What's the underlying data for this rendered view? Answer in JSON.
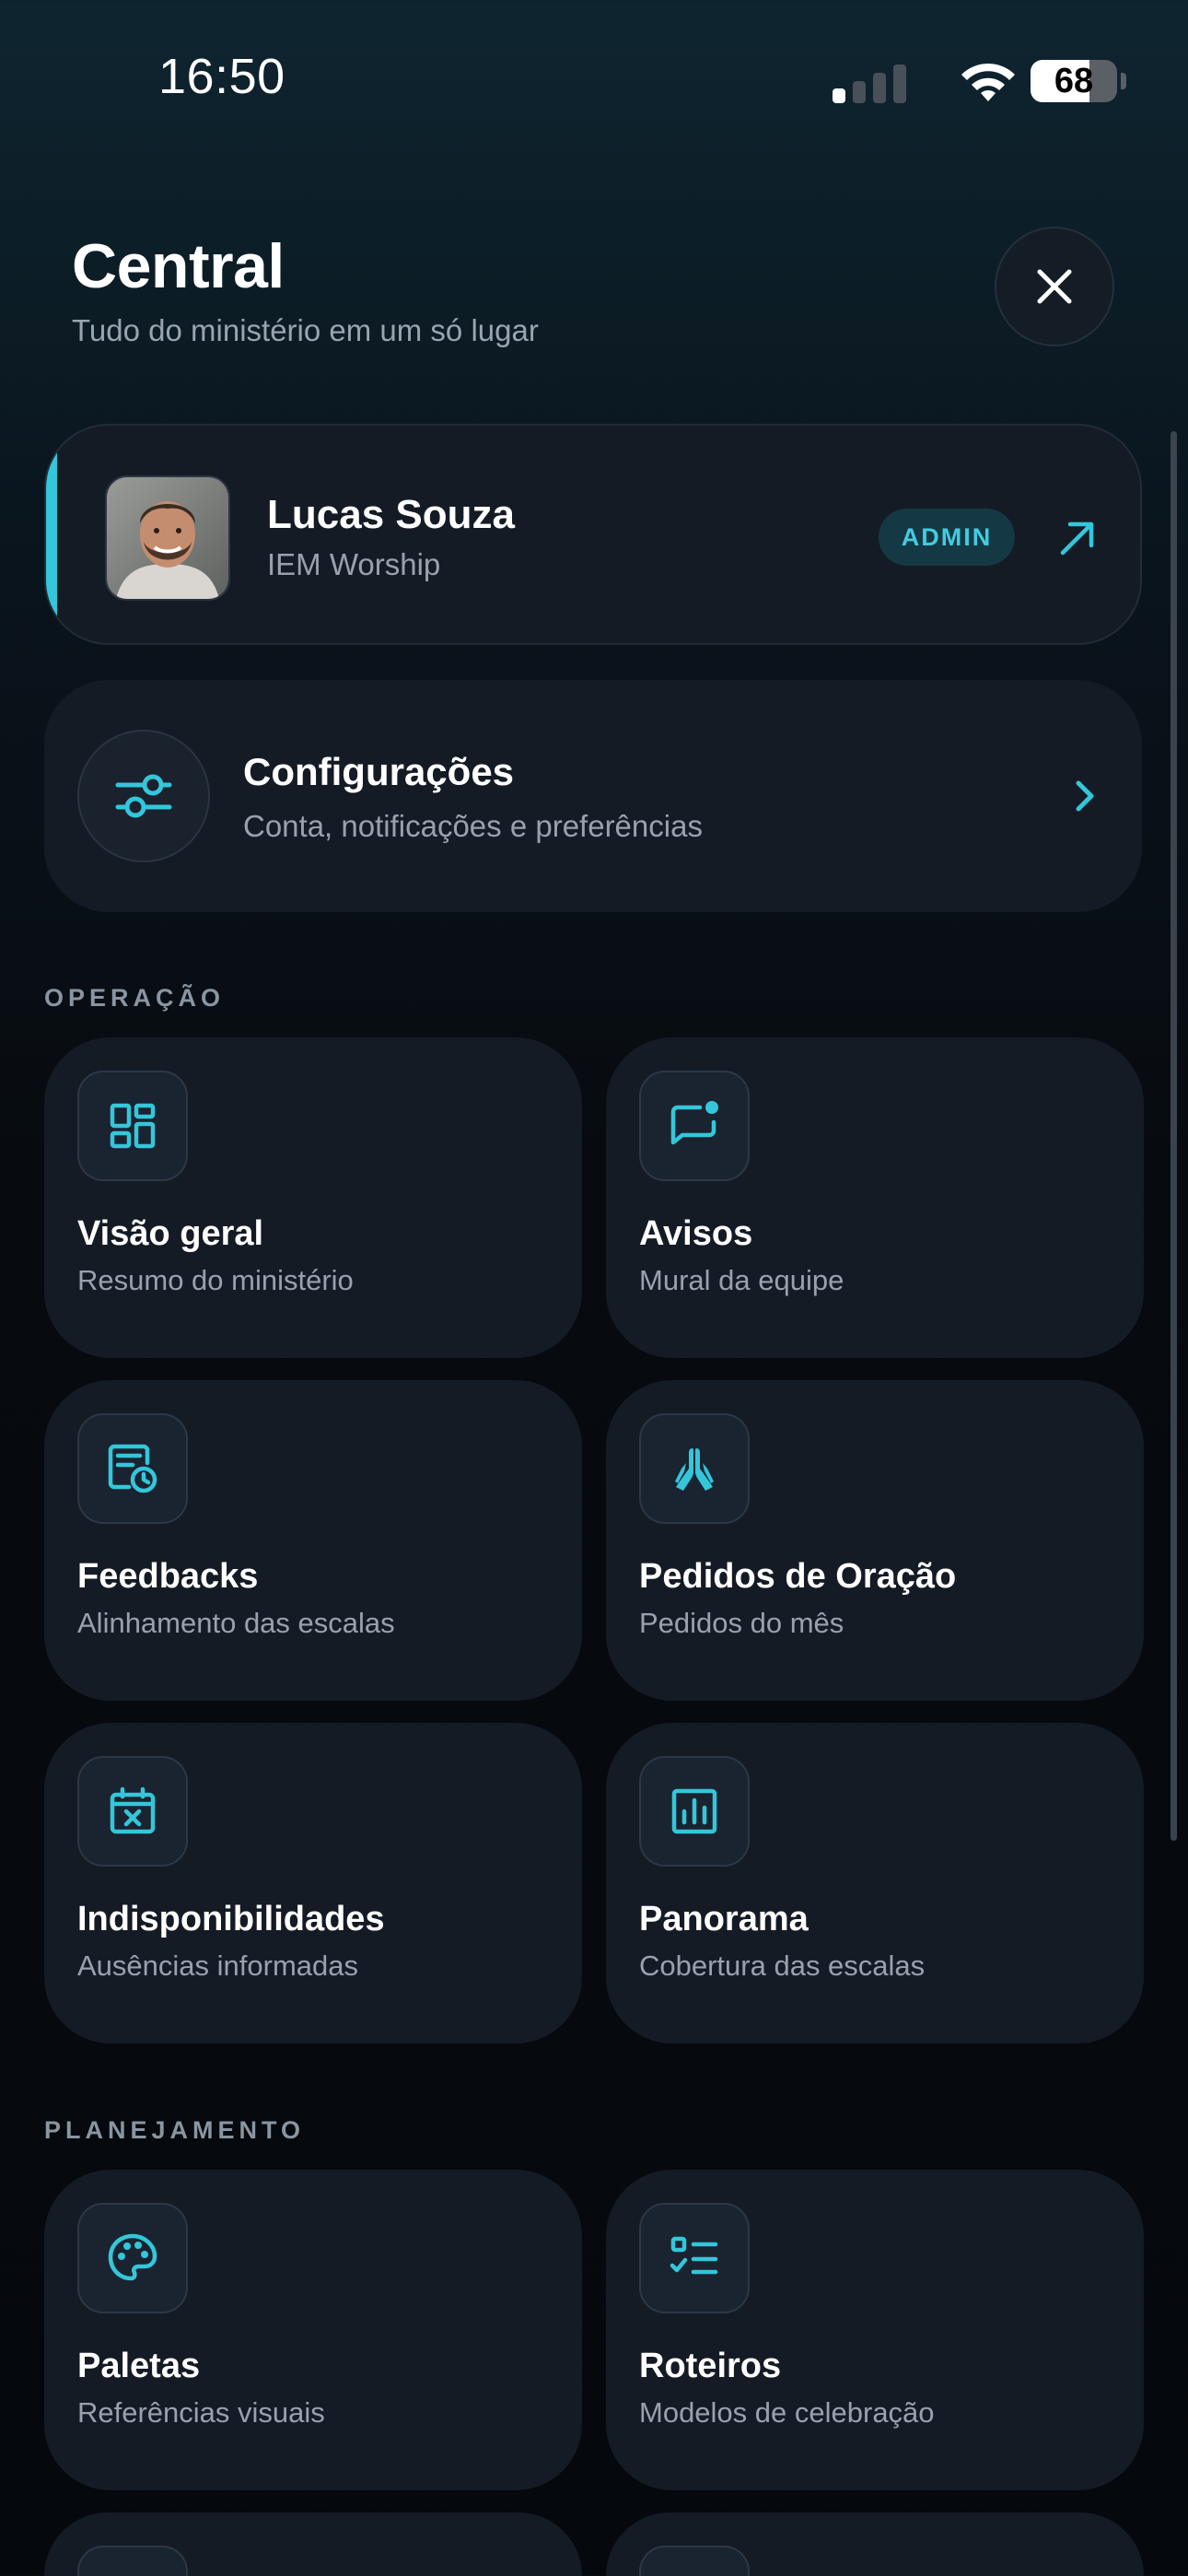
{
  "status_bar": {
    "time": "16:50",
    "battery_level": "68",
    "battery_fraction": 0.68,
    "signal_icon": "cellular-signal-icon",
    "wifi_icon": "wifi-icon"
  },
  "header": {
    "title": "Central",
    "subtitle": "Tudo do ministério em um só lugar",
    "close_icon": "close-icon"
  },
  "profile": {
    "name": "Lucas Souza",
    "organization": "IEM Worship",
    "role_badge": "ADMIN",
    "open_icon": "arrow-up-right-icon"
  },
  "settings": {
    "title": "Configurações",
    "subtitle": "Conta, notificações e preferências",
    "icon": "sliders-icon",
    "chevron_icon": "chevron-right-icon"
  },
  "sections": [
    {
      "label": "OPERAÇÃO",
      "items": [
        {
          "title": "Visão geral",
          "subtitle": "Resumo do ministério",
          "icon": "dashboard-icon"
        },
        {
          "title": "Avisos",
          "subtitle": "Mural da equipe",
          "icon": "message-notification-icon"
        },
        {
          "title": "Feedbacks",
          "subtitle": "Alinhamento das escalas",
          "icon": "document-clock-icon"
        },
        {
          "title": "Pedidos de Oração",
          "subtitle": "Pedidos do mês",
          "icon": "praying-hands-icon"
        },
        {
          "title": "Indisponibilidades",
          "subtitle": "Ausências informadas",
          "icon": "calendar-x-icon"
        },
        {
          "title": "Panorama",
          "subtitle": "Cobertura das escalas",
          "icon": "bar-chart-icon"
        }
      ]
    },
    {
      "label": "PLANEJAMENTO",
      "items": [
        {
          "title": "Paletas",
          "subtitle": "Referências visuais",
          "icon": "palette-icon"
        },
        {
          "title": "Roteiros",
          "subtitle": "Modelos de celebração",
          "icon": "checklist-icon"
        }
      ]
    }
  ],
  "colors": {
    "accent": "#34c6da",
    "card": "#151b25",
    "text_secondary": "#98a2ae"
  }
}
